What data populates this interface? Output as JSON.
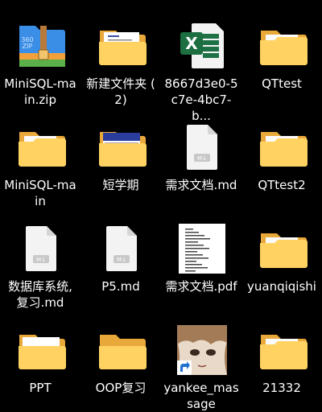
{
  "desktop": {
    "items": [
      {
        "label": "MiniSQL-main.zip",
        "label_lines": [
          "MiniSQL-ma",
          "in.zip"
        ],
        "icon": "zip-archive-icon",
        "type": "zip"
      },
      {
        "label": "新建文件夹 (2)",
        "label_lines": [
          "新建文件夹 (",
          "2)"
        ],
        "icon": "folder-with-document-icon",
        "type": "folder-doc"
      },
      {
        "label": "8667d3e0-5c7e-4bc7-b...",
        "label_lines": [
          "8667d3e0-5",
          "c7e-4bc7-b..."
        ],
        "icon": "excel-file-icon",
        "type": "excel"
      },
      {
        "label": "QTtest",
        "label_lines": [
          "QTtest",
          ""
        ],
        "icon": "folder-icon",
        "type": "folder-paper"
      },
      {
        "label": "MiniSQL-main",
        "label_lines": [
          "MiniSQL-ma",
          "in"
        ],
        "icon": "folder-icon",
        "type": "folder-paper"
      },
      {
        "label": "短学期",
        "label_lines": [
          "短学期",
          ""
        ],
        "icon": "folder-with-screenshot-icon",
        "type": "folder-blue"
      },
      {
        "label": "需求文档.md",
        "label_lines": [
          "需求文档.md",
          ""
        ],
        "icon": "markdown-file-icon",
        "type": "md"
      },
      {
        "label": "QTtest2",
        "label_lines": [
          "QTtest2",
          ""
        ],
        "icon": "folder-icon",
        "type": "folder-paper"
      },
      {
        "label": "数据库系统,复习.md",
        "label_lines": [
          "数据库系统,",
          "复习.md"
        ],
        "icon": "markdown-file-icon",
        "type": "md"
      },
      {
        "label": "P5.md",
        "label_lines": [
          "P5.md",
          ""
        ],
        "icon": "markdown-file-icon",
        "type": "md"
      },
      {
        "label": "需求文档.pdf",
        "label_lines": [
          "需求文档.pdf",
          ""
        ],
        "icon": "pdf-thumbnail-icon",
        "type": "pdf"
      },
      {
        "label": "yuanqiqishi",
        "label_lines": [
          "yuanqiqishi",
          ""
        ],
        "icon": "folder-icon",
        "type": "folder-paper"
      },
      {
        "label": "PPT",
        "label_lines": [
          "PPT",
          ""
        ],
        "icon": "folder-icon",
        "type": "folder-white"
      },
      {
        "label": "OOP复习",
        "label_lines": [
          "OOP复习",
          ""
        ],
        "icon": "empty-folder-icon",
        "type": "folder-empty"
      },
      {
        "label": "yankee_massage",
        "label_lines": [
          "yankee_mas",
          "sage"
        ],
        "icon": "anime-image-shortcut-icon",
        "type": "image"
      },
      {
        "label": "21332",
        "label_lines": [
          "21332",
          ""
        ],
        "icon": "folder-icon",
        "type": "folder-paper"
      }
    ],
    "colors": {
      "background": "#000000",
      "folder_back": "#f2b73f",
      "folder_front": "#ffd262",
      "excel_green": "#1e7145",
      "zip_blue": "#3a8ee6"
    }
  }
}
